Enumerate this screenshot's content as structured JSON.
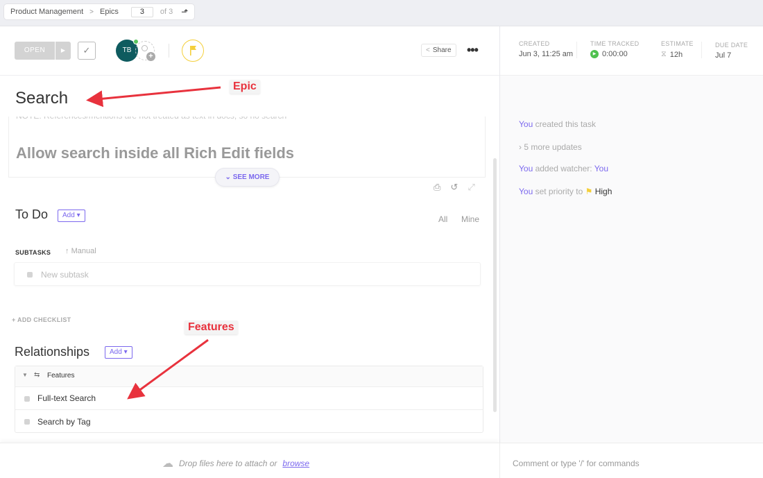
{
  "breadcrumb": {
    "items": [
      "Product Management",
      "Epics"
    ],
    "page_current": "3",
    "page_total_label": "of 3"
  },
  "header": {
    "status_label": "OPEN",
    "assignee_initials": "TB",
    "assignee_color": "#0e5b5f",
    "priority_color": "#f4cf3a",
    "share_label": "Share",
    "more_label": "•••"
  },
  "meta": {
    "created_label": "Created",
    "created_value": "Jun 3, 11:25 am",
    "time_tracked_label": "Time Tracked",
    "time_tracked_value": "0:00:00",
    "estimate_label": "Estimate",
    "estimate_value": "12h",
    "due_label": "Due Date",
    "due_value": "Jul 7"
  },
  "task": {
    "title": "Search",
    "description_note": "NOTE: References/mentions are not treated as text in docs, so no search",
    "description_heading": "Allow search inside all Rich Edit fields",
    "see_more_label": "SEE MORE"
  },
  "todo": {
    "title": "To Do",
    "add_label": "Add",
    "filters": [
      "All",
      "Mine"
    ],
    "subtasks_label": "SUBTASKS",
    "sort_label": "Manual",
    "new_subtask_placeholder": "New subtask",
    "add_checklist_label": "+ ADD CHECKLIST"
  },
  "relationships": {
    "title": "Relationships",
    "add_label": "Add",
    "group_label": "Features",
    "items": [
      "Full-text Search",
      "Search by Tag"
    ]
  },
  "activity": [
    {
      "actor": "You",
      "text": " created this task"
    },
    {
      "more": "5 more updates"
    },
    {
      "actor": "You",
      "text": " added watcher: ",
      "target": "You"
    },
    {
      "actor": "You",
      "text": " set priority to ",
      "priority": "High"
    }
  ],
  "footer": {
    "drop_text": "Drop files here to attach or",
    "browse_label": "browse",
    "comment_placeholder": "Comment or type '/' for commands"
  },
  "annotations": {
    "epic": "Epic",
    "features": "Features",
    "color": "#e8323d"
  }
}
